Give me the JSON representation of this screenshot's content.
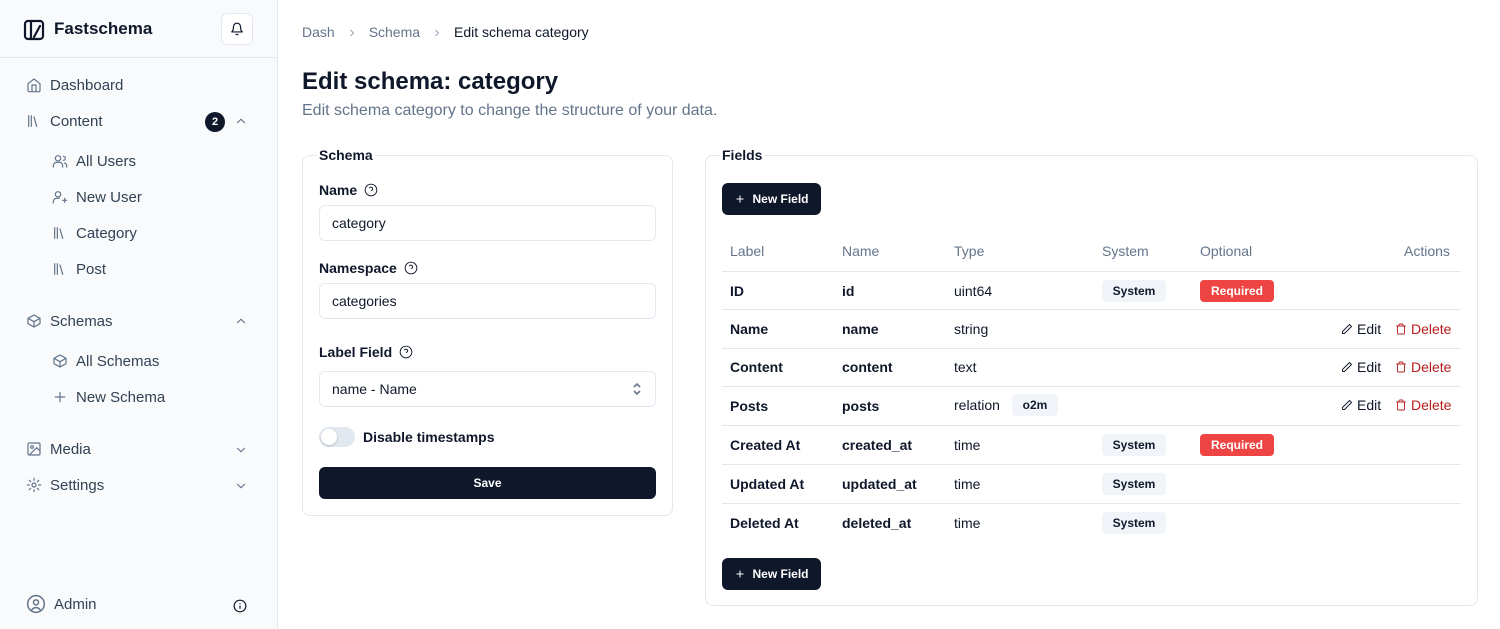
{
  "app": {
    "brand": "Fastschema"
  },
  "sidebar": {
    "items": [
      {
        "label": "Dashboard",
        "icon": "home-icon"
      },
      {
        "label": "Content",
        "icon": "library-icon",
        "badge": "2"
      },
      {
        "label": "All Users",
        "icon": "users-icon"
      },
      {
        "label": "New User",
        "icon": "user-plus-icon"
      },
      {
        "label": "Category",
        "icon": "library-icon"
      },
      {
        "label": "Post",
        "icon": "library-icon"
      },
      {
        "label": "Schemas",
        "icon": "box-icon"
      },
      {
        "label": "All Schemas",
        "icon": "box-icon"
      },
      {
        "label": "New Schema",
        "icon": "plus-icon"
      },
      {
        "label": "Media",
        "icon": "image-icon"
      },
      {
        "label": "Settings",
        "icon": "gear-icon"
      }
    ],
    "user": "Admin"
  },
  "breadcrumb": [
    "Dash",
    "Schema",
    "Edit schema category"
  ],
  "page": {
    "title": "Edit schema: category",
    "subtitle": "Edit schema category to change the structure of your data."
  },
  "schema_form": {
    "legend": "Schema",
    "name_label": "Name",
    "name_value": "category",
    "namespace_label": "Namespace",
    "namespace_value": "categories",
    "label_field_label": "Label Field",
    "label_field_value": "name - Name",
    "disable_timestamps_label": "Disable timestamps",
    "disable_timestamps_on": false,
    "save_label": "Save"
  },
  "fields": {
    "legend": "Fields",
    "new_field_label": "New Field",
    "headers": [
      "Label",
      "Name",
      "Type",
      "System",
      "Optional",
      "Actions"
    ],
    "rows": [
      {
        "label": "ID",
        "name": "id",
        "type": "uint64",
        "relation": "",
        "system": "System",
        "optional": "Required",
        "edit": "",
        "delete": ""
      },
      {
        "label": "Name",
        "name": "name",
        "type": "string",
        "relation": "",
        "system": "",
        "optional": "",
        "edit": "Edit",
        "delete": "Delete"
      },
      {
        "label": "Content",
        "name": "content",
        "type": "text",
        "relation": "",
        "system": "",
        "optional": "",
        "edit": "Edit",
        "delete": "Delete"
      },
      {
        "label": "Posts",
        "name": "posts",
        "type": "relation",
        "relation": "o2m",
        "system": "",
        "optional": "",
        "edit": "Edit",
        "delete": "Delete"
      },
      {
        "label": "Created At",
        "name": "created_at",
        "type": "time",
        "relation": "",
        "system": "System",
        "optional": "Required",
        "edit": "",
        "delete": ""
      },
      {
        "label": "Updated At",
        "name": "updated_at",
        "type": "time",
        "relation": "",
        "system": "System",
        "optional": "",
        "edit": "",
        "delete": ""
      },
      {
        "label": "Deleted At",
        "name": "deleted_at",
        "type": "time",
        "relation": "",
        "system": "System",
        "optional": "",
        "edit": "",
        "delete": ""
      }
    ]
  },
  "colors": {
    "primary": "#0f172a",
    "danger": "#ef4444",
    "delete_text": "#b91c1c",
    "muted": "#64748b"
  }
}
